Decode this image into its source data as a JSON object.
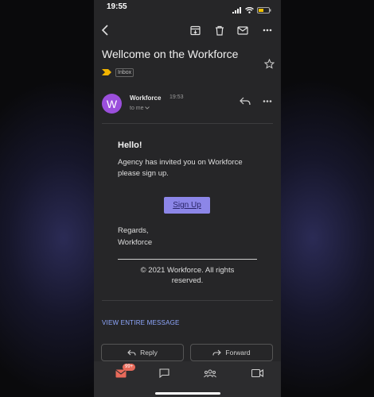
{
  "status_bar": {
    "time": "19:55"
  },
  "email": {
    "subject": "Wellcome on the Workforce",
    "label": "Inbox",
    "sender": {
      "initial": "W",
      "name": "Workforce",
      "time": "19:53",
      "to": "to me"
    },
    "body": {
      "greeting": "Hello!",
      "message": "Agency has invited you on Workforce please sign up.",
      "button": "Sign Up",
      "regards_line1": "Regards,",
      "regards_line2": "Workforce",
      "copyright": "© 2021 Workforce. All rights reserved."
    },
    "view_entire": "VIEW ENTIRE MESSAGE"
  },
  "actions": {
    "reply": "Reply",
    "forward": "Forward"
  },
  "bottom_nav": {
    "mail_badge": "99+"
  },
  "colors": {
    "accent": "#8c86e8",
    "avatar": "#9b4fdc",
    "link": "#8fa8ff",
    "important": "#f2b400"
  }
}
